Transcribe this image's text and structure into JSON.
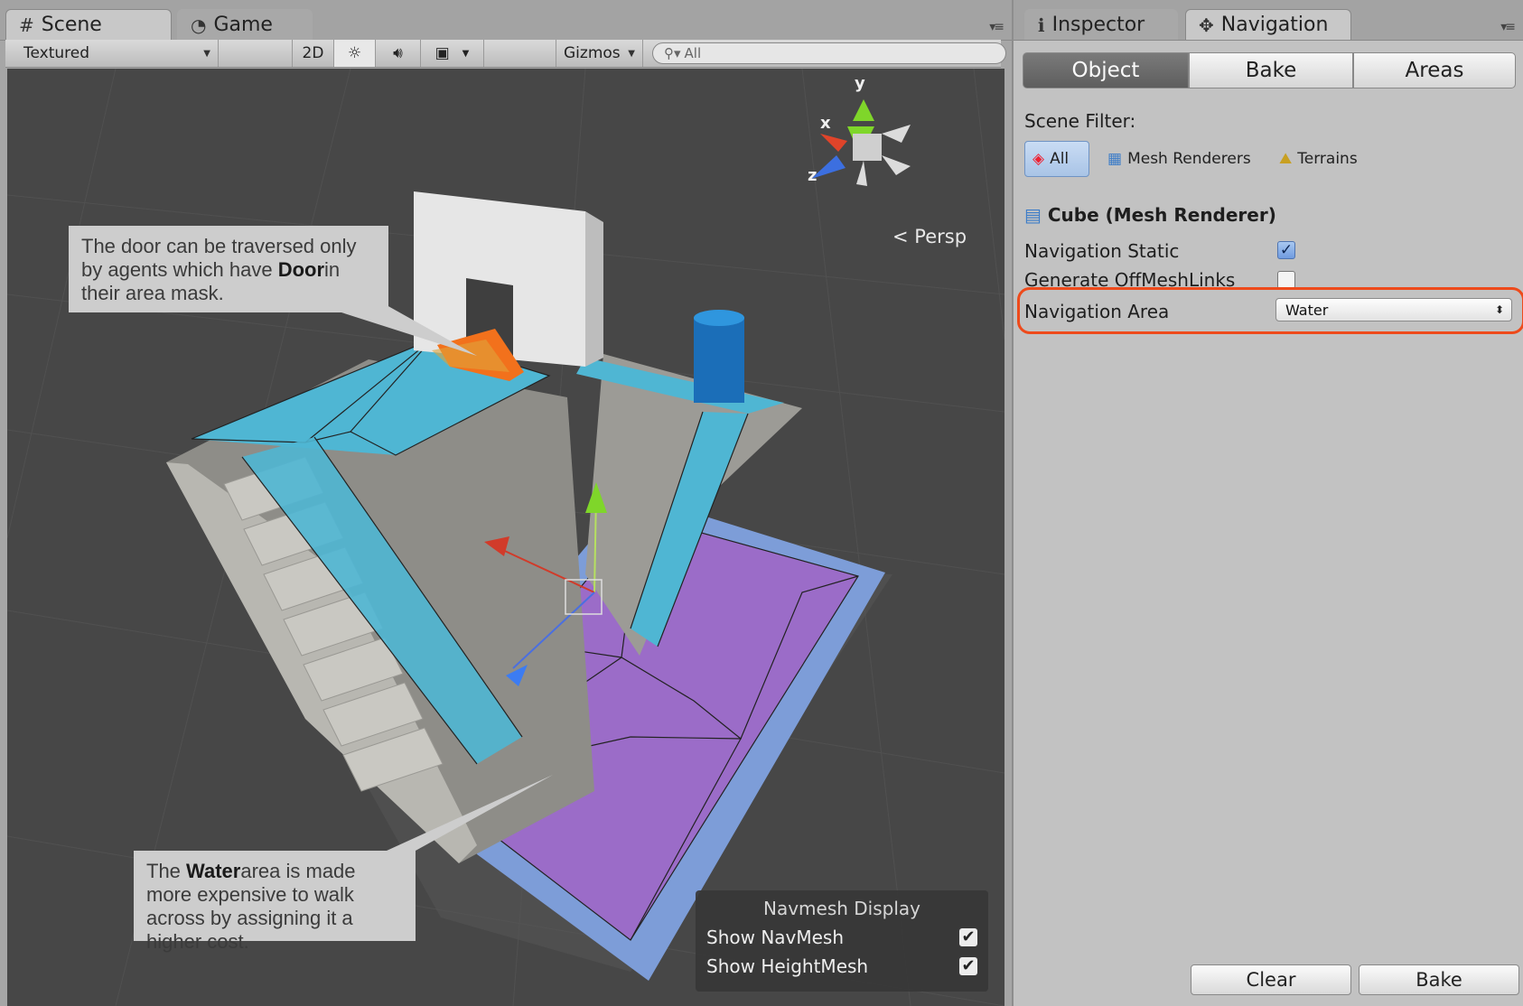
{
  "scene_tabs": {
    "scene": "Scene",
    "game": "Game"
  },
  "toolbar": {
    "shading_mode": "Textured",
    "mode_2d": "2D",
    "gizmos": "Gizmos",
    "search_placeholder": "All"
  },
  "viewport": {
    "persp_label": "Persp",
    "gizmo_axes": {
      "x": "x",
      "y": "y",
      "z": "z"
    },
    "callout_door": {
      "pre": "The door can be traversed only by agents which have ",
      "bold": "Door",
      "post": "in their area mask."
    },
    "callout_water": {
      "pre": "The ",
      "bold": "Water",
      "post": "area is made more expensive to walk across by assigning it a higher cost."
    },
    "navmesh_display": {
      "title": "Navmesh Display",
      "show_navmesh": "Show NavMesh",
      "show_heightmesh": "Show HeightMesh",
      "show_navmesh_checked": true,
      "show_heightmesh_checked": true
    }
  },
  "right_tabs": {
    "inspector": "Inspector",
    "navigation": "Navigation"
  },
  "nav_tabs": {
    "object": "Object",
    "bake": "Bake",
    "areas": "Areas"
  },
  "scene_filter": {
    "label": "Scene Filter:",
    "all": "All",
    "mesh_renderers": "Mesh Renderers",
    "terrains": "Terrains"
  },
  "object": {
    "title": "Cube (Mesh Renderer)",
    "navigation_static_label": "Navigation Static",
    "navigation_static": true,
    "generate_offmeshlinks_label": "Generate OffMeshLinks",
    "generate_offmeshlinks": false,
    "navigation_area_label": "Navigation Area",
    "navigation_area_value": "Water"
  },
  "footer": {
    "clear": "Clear",
    "bake": "Bake"
  },
  "colors": {
    "navmesh_walkable": "#4fb6d3",
    "navmesh_water": "#a36ad6",
    "navmesh_door": "#f2711c",
    "highlight": "#ee4a1b"
  }
}
